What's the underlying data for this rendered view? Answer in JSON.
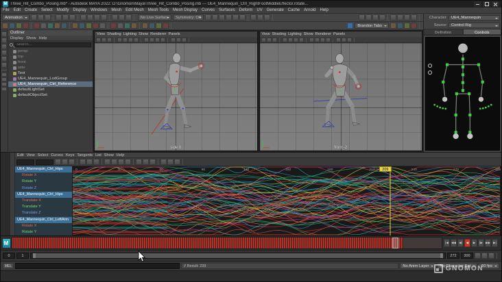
{
  "titlebar": {
    "title": "Three_Hit_Combo_Posing.mb* - Autodesk MAYA 2022: D:\\Gnomon\\Maya\\Three_Hit_Combo_Posing.mb --- UE4_Mannequin_Ctrl_RightFootMiddleEffector.rotate...",
    "app_badge": "M"
  },
  "menubar": {
    "items": [
      "File",
      "Edit",
      "Create",
      "Select",
      "Modify",
      "Display",
      "Windows",
      "Mesh",
      "Edit Mesh",
      "Mesh Tools",
      "Mesh Display",
      "Curves",
      "Surfaces",
      "Deform",
      "UV",
      "Generate",
      "Cache",
      "Arnold",
      "Help"
    ]
  },
  "statusline": {
    "menu_set": "Animation",
    "no_live_surface": "No Live Surface",
    "symmetry": "Symmetry: Off"
  },
  "shelf": {
    "dropdown_label": "Brandon Tabs"
  },
  "outliner": {
    "title": "Outliner",
    "menu": [
      "Display",
      "Show",
      "Help"
    ],
    "search_placeholder": "Search...",
    "items": [
      {
        "label": "persp",
        "muted": true,
        "icon": "#8a8a8a"
      },
      {
        "label": "top",
        "muted": true,
        "icon": "#8a8a8a"
      },
      {
        "label": "front",
        "muted": true,
        "icon": "#8a8a8a"
      },
      {
        "label": "side",
        "muted": true,
        "icon": "#8a8a8a"
      },
      {
        "label": "Text",
        "icon": "#b0a060"
      },
      {
        "label": "UE4_Mannequin_LodGroup",
        "icon": "#9a7ab0"
      },
      {
        "label": "UE4_Mannequin_Ctrl_Reference",
        "selected": true,
        "icon": "#c08080"
      },
      {
        "label": "defaultLightSet",
        "icon": "#88aa66"
      },
      {
        "label": "defaultObjectSet",
        "icon": "#88aa66"
      }
    ]
  },
  "viewports": [
    {
      "menu": [
        "View",
        "Shading",
        "Lighting",
        "Show",
        "Renderer",
        "Panels"
      ],
      "label": "side 8"
    },
    {
      "menu": [
        "View",
        "Shading",
        "Lighting",
        "Show",
        "Renderer",
        "Panels"
      ],
      "label": "front -2"
    }
  ],
  "character_panel": {
    "character_label": "Character:",
    "character_value": "UE4_Mannequin",
    "source_label": "Source:",
    "source_value": "Control Rig",
    "tabs": [
      {
        "label": "Definition",
        "active": false
      },
      {
        "label": "Controls",
        "active": true
      }
    ]
  },
  "graph_editor": {
    "menu": [
      "Edit",
      "View",
      "Select",
      "Curves",
      "Keys",
      "Tangents",
      "List",
      "Show",
      "Help"
    ],
    "channels": [
      {
        "label": "UE4_Mannequin_Ctrl_Hips",
        "selected": true
      },
      {
        "label": "Rotate X",
        "sub": true,
        "color": "#e06a5a"
      },
      {
        "label": "Rotate Y",
        "sub": true,
        "color": "#78d878"
      },
      {
        "label": "Rotate Z",
        "sub": true,
        "color": "#7898e8"
      },
      {
        "label": "UE4_Mannequin_Ctrl_Hips",
        "selected": true
      },
      {
        "label": "Translate X",
        "sub": true,
        "color": "#e06a5a"
      },
      {
        "label": "Translate Y",
        "sub": true,
        "color": "#78d878"
      },
      {
        "label": "Translate Z",
        "sub": true,
        "color": "#7898e8"
      },
      {
        "label": "UE4_Mannequin_Ctrl_LeftArm",
        "selected": true
      },
      {
        "label": "Rotate X",
        "sub": true,
        "color": "#e06a5a"
      },
      {
        "label": "Rotate Y",
        "sub": true,
        "color": "#78d878"
      }
    ],
    "ruler": [
      "0",
      "30",
      "60",
      "90",
      "120",
      "150",
      "180",
      "210",
      "240",
      "270",
      "300"
    ],
    "current_frame": "209",
    "curve_colors": [
      "#c0392b",
      "#d35445",
      "#27ae60",
      "#2e86c1",
      "#17a2b2",
      "#b03ab0",
      "#c8c84a",
      "#e07b39",
      "#cc3333",
      "#2aa198"
    ]
  },
  "playback": {
    "buttons": [
      {
        "name": "go-to-start-button",
        "glyph": "|◀"
      },
      {
        "name": "step-back-frame-button",
        "glyph": "◀◀"
      },
      {
        "name": "step-back-key-button",
        "glyph": "◀|"
      },
      {
        "name": "play-backwards-button",
        "glyph": "◀",
        "red": true
      },
      {
        "name": "play-forwards-button",
        "glyph": "▶"
      },
      {
        "name": "step-forward-key-button",
        "glyph": "|▶"
      },
      {
        "name": "step-forward-frame-button",
        "glyph": "▶▶"
      },
      {
        "name": "go-to-end-button",
        "glyph": "▶|"
      }
    ]
  },
  "range_slider": {
    "start": "0",
    "playback_start": "1",
    "playback_end": "272",
    "end": "300"
  },
  "status_bottom": {
    "anim_layer": "No Anim Layer",
    "character_set": "No Character Set",
    "fps": "60 fps"
  },
  "command_line": {
    "mel_label": "MEL",
    "result": "// Result: 239"
  },
  "watermark": {
    "text": "GNOMON"
  }
}
